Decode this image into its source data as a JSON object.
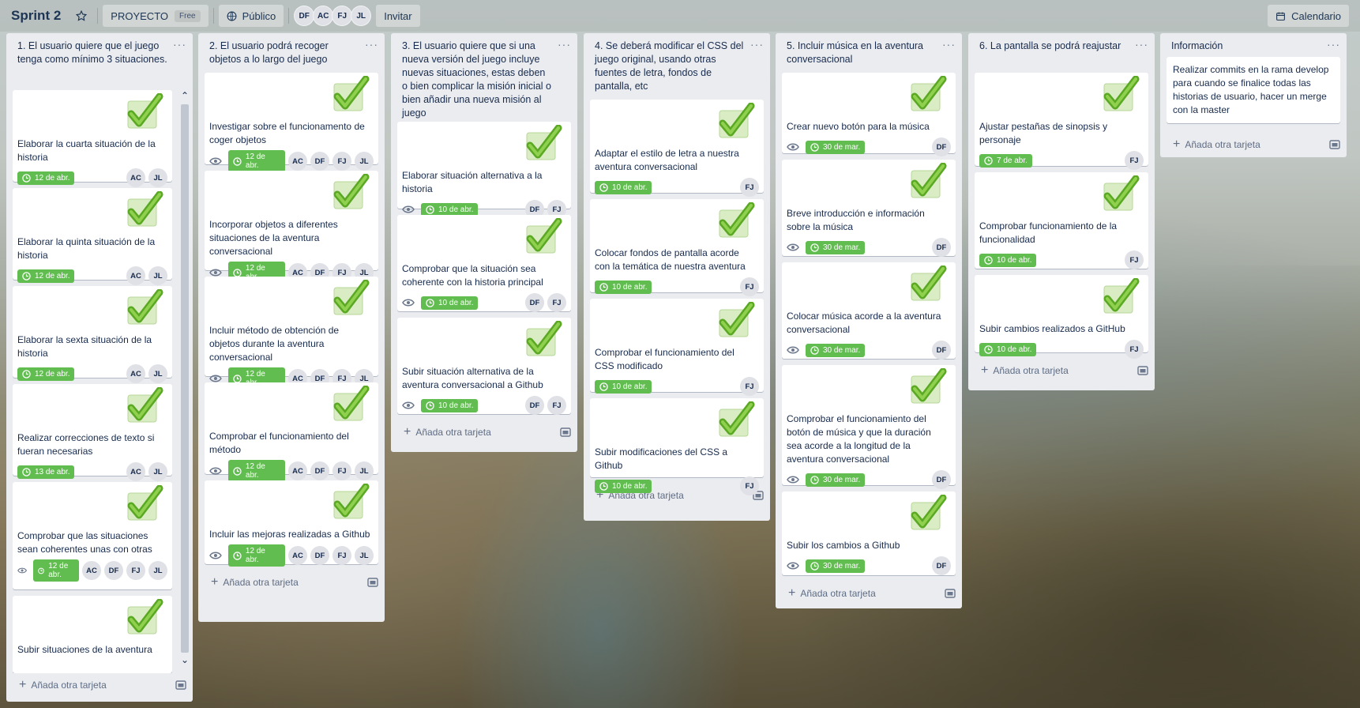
{
  "header": {
    "board_title": "Sprint 2",
    "workspace": "PROYECTO",
    "plan_badge": "Free",
    "visibility": "Público",
    "members": [
      "DF",
      "AC",
      "FJ",
      "JL"
    ],
    "invite": "Invitar",
    "calendar": "Calendario"
  },
  "add_card_label": "Añada otra tarjeta",
  "lists": [
    {
      "title": "1. El usuario quiere que el juego tenga como mínimo 3 situaciones.",
      "cards": [
        {
          "title": "Elaborar la cuarta situación de la historia",
          "due": "12 de abr.",
          "members": [
            "AC",
            "JL"
          ]
        },
        {
          "title": "Elaborar la quinta situación de la historia",
          "due": "12 de abr.",
          "members": [
            "AC",
            "JL"
          ]
        },
        {
          "title": "Elaborar la sexta situación de la historia",
          "due": "12 de abr.",
          "members": [
            "AC",
            "JL"
          ]
        },
        {
          "title": "Realizar correcciones de texto si fueran necesarias",
          "due": "13 de abr.",
          "members": [
            "AC",
            "JL"
          ]
        },
        {
          "title": "Comprobar que las situaciones sean coherentes unas con otras",
          "due": "12 de abr.",
          "members": [
            "AC",
            "DF",
            "FJ",
            "JL"
          ]
        },
        {
          "title": "Subir situaciones de la aventura",
          "due": "",
          "members": []
        }
      ]
    },
    {
      "title": "2. El usuario podrá recoger objetos a lo largo del juego",
      "cards": [
        {
          "title": "Investigar sobre el funcionamento de coger objetos",
          "due": "12 de abr.",
          "members": [
            "AC",
            "DF",
            "FJ",
            "JL"
          ]
        },
        {
          "title": "Incorporar objetos a diferentes situaciones de la aventura conversacional",
          "due": "12 de abr.",
          "members": [
            "AC",
            "DF",
            "FJ",
            "JL"
          ]
        },
        {
          "title": "Incluir método de obtención de objetos durante la aventura conversacional",
          "due": "12 de abr.",
          "members": [
            "AC",
            "DF",
            "FJ",
            "JL"
          ]
        },
        {
          "title": "Comprobar el funcionamiento del método",
          "due": "12 de abr.",
          "members": [
            "AC",
            "DF",
            "FJ",
            "JL"
          ]
        },
        {
          "title": "Incluir las mejoras realizadas a Github",
          "due": "12 de abr.",
          "members": [
            "AC",
            "DF",
            "FJ",
            "JL"
          ]
        }
      ]
    },
    {
      "title": "3. El usuario quiere que si una nueva versión del juego incluye nuevas situaciones, estas deben o bien complicar la misión inicial o bien añadir una nueva misión al juego",
      "cards": [
        {
          "title": "Elaborar situación alternativa a la historia",
          "due": "10 de abr.",
          "members": [
            "DF",
            "FJ"
          ]
        },
        {
          "title": "Comprobar que la situación sea coherente con la historia principal",
          "due": "10 de abr.",
          "members": [
            "DF",
            "FJ"
          ]
        },
        {
          "title": "Subir situación alternativa de la aventura conversacional a Github",
          "due": "10 de abr.",
          "members": [
            "DF",
            "FJ"
          ]
        }
      ]
    },
    {
      "title": "4. Se deberá modificar el CSS del juego original, usando otras fuentes de letra, fondos de pantalla, etc",
      "cards": [
        {
          "title": "Adaptar el estilo de letra a nuestra aventura conversacional",
          "due": "10 de abr.",
          "members": [
            "FJ"
          ]
        },
        {
          "title": "Colocar fondos de pantalla acorde con la temática de nuestra aventura",
          "due": "10 de abr.",
          "members": [
            "FJ"
          ]
        },
        {
          "title": "Comprobar el funcionamiento del CSS modificado",
          "due": "10 de abr.",
          "members": [
            "FJ"
          ]
        },
        {
          "title": "Subir modificaciones del CSS a Github",
          "due": "10 de abr.",
          "members": [
            "FJ"
          ]
        }
      ]
    },
    {
      "title": "5. Incluir música en la aventura conversacional",
      "cards": [
        {
          "title": "Crear nuevo botón para la música",
          "due": "30 de mar.",
          "members": [
            "DF"
          ]
        },
        {
          "title": "Breve introducción e información sobre la música",
          "due": "30 de mar.",
          "members": [
            "DF"
          ]
        },
        {
          "title": "Colocar música acorde a la aventura conversacional",
          "due": "30 de mar.",
          "members": [
            "DF"
          ]
        },
        {
          "title": "Comprobar el funcionamiento del botón de música y que la duración sea acorde a la longitud de la aventura conversacional",
          "due": "30 de mar.",
          "members": [
            "DF"
          ]
        },
        {
          "title": "Subir los cambios a Github",
          "due": "30 de mar.",
          "members": [
            "DF"
          ]
        }
      ]
    },
    {
      "title": "6. La pantalla se podrá reajustar",
      "cards": [
        {
          "title": "Ajustar pestañas de sinopsis y personaje",
          "due": "7 de abr.",
          "members": [
            "FJ"
          ]
        },
        {
          "title": "Comprobar funcionamiento de la funcionalidad",
          "due": "10 de abr.",
          "members": [
            "FJ"
          ]
        },
        {
          "title": "Subir cambios realizados a GitHub",
          "due": "10 de abr.",
          "members": [
            "FJ"
          ]
        }
      ]
    },
    {
      "title": "Información",
      "info": "Realizar commits en la rama develop para cuando se finalice todas las historias de usuario, hacer un merge con la master"
    }
  ],
  "colors": {
    "due_green": "#61bd4f",
    "check_green": "#7ac943",
    "list_bg": "#ebecf0"
  },
  "icons": [
    "star-icon",
    "globe-icon",
    "calendar-icon",
    "eye-icon",
    "clock-icon",
    "checkmark-icon",
    "template-icon"
  ]
}
